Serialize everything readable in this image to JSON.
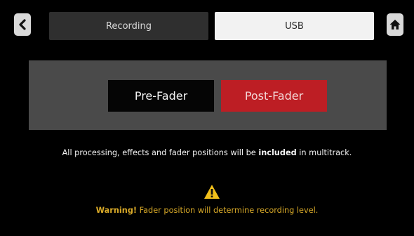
{
  "header": {
    "back_icon": "chevron-left-icon",
    "home_icon": "home-icon",
    "tabs": [
      {
        "label": "Recording",
        "selected": false
      },
      {
        "label": "USB",
        "selected": true
      }
    ]
  },
  "tap_point": {
    "options": [
      {
        "label": "Pre-Fader",
        "selected": false
      },
      {
        "label": "Post-Fader",
        "selected": true
      }
    ],
    "selected_color": "#bd1e24"
  },
  "info": {
    "prefix": "All processing, effects and fader positions will be",
    "emphasis": "included",
    "suffix": "in multitrack."
  },
  "warning": {
    "icon": "warning-triangle-icon",
    "prefix": "Warning!",
    "message": "Fader position will determine recording level.",
    "color": "#d8a928"
  }
}
